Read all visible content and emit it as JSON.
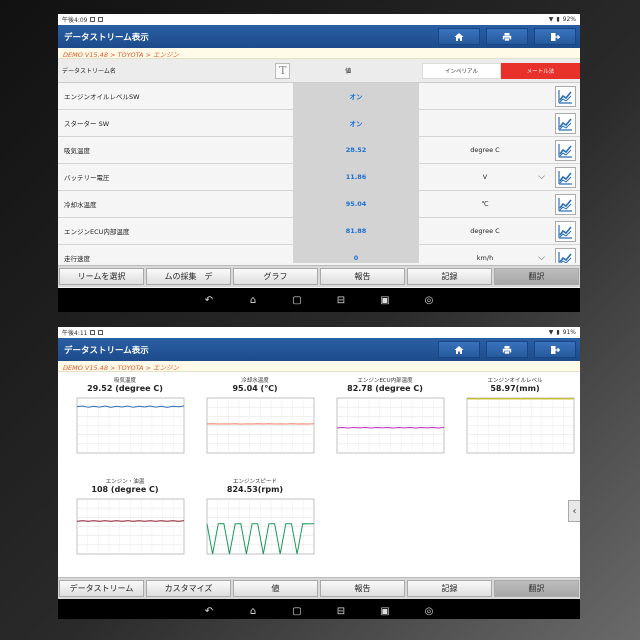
{
  "screen1": {
    "status": {
      "time": "午後4:09",
      "battery": "92%"
    },
    "title": "データストリーム表示",
    "breadcrumb": "DEMO V15.48 > TOYOTA > エンジン",
    "header": {
      "name": "データストリーム名",
      "value": "値",
      "imperial": "インペリアル",
      "metric": "メートル法"
    },
    "rows": [
      {
        "name": "エンジンオイルレベルSW",
        "value": "オン",
        "unit": "",
        "dropdown": false
      },
      {
        "name": "スターター SW",
        "value": "オン",
        "unit": "",
        "dropdown": false
      },
      {
        "name": "吸気温度",
        "value": "28.52",
        "unit": "degree C",
        "dropdown": false
      },
      {
        "name": "バッテリー電圧",
        "value": "11.86",
        "unit": "V",
        "dropdown": true
      },
      {
        "name": "冷却水温度",
        "value": "95.04",
        "unit": "℃",
        "dropdown": false
      },
      {
        "name": "エンジンECU内部温度",
        "value": "81.88",
        "unit": "degree C",
        "dropdown": false
      },
      {
        "name": "走行速度",
        "value": "0",
        "unit": "km/h",
        "dropdown": true
      }
    ],
    "buttons": [
      "リームを選択",
      "ムの採集　デ",
      "グラフ",
      "報告",
      "記録",
      "翻訳"
    ]
  },
  "screen2": {
    "status": {
      "time": "午後4:11",
      "battery": "91%"
    },
    "title": "データストリーム表示",
    "breadcrumb": "DEMO V15.48 > TOYOTA > エンジン",
    "buttons": [
      "データストリーム",
      "カスタマイズ",
      "値",
      "報告",
      "記録",
      "翻訳"
    ]
  },
  "chart_data": [
    {
      "type": "line",
      "title": "吸気温度",
      "value_label": "29.52 (degree C)",
      "series": [
        {
          "values": [
            29.5,
            29.9,
            29.1,
            29.8,
            29.2,
            29.9,
            29.0,
            29.7,
            29.3,
            29.9,
            29.1,
            29.8,
            29.3,
            29.9,
            29.2,
            29.7,
            29.0,
            29.8,
            29.4,
            29.9
          ]
        }
      ],
      "ylim": [
        0,
        35
      ],
      "color": "#2b6fb5"
    },
    {
      "type": "line",
      "title": "冷却水温度",
      "value_label": "95.04 (℃)",
      "series": [
        {
          "values": [
            95,
            95.5,
            94.8,
            95.3,
            94.9,
            95.6,
            94.7,
            95.2,
            95.0,
            95.5,
            94.8,
            95.4,
            95.0,
            95.3,
            94.9,
            95.5,
            94.8,
            95.2,
            95.0,
            95.4
          ]
        }
      ],
      "ylim": [
        0,
        180
      ],
      "color": "#f08060"
    },
    {
      "type": "line",
      "title": "エンジンECU内部温度",
      "value_label": "82.78 (degree C)",
      "series": [
        {
          "values": [
            82,
            83.5,
            81.9,
            83.6,
            82.0,
            83.4,
            81.8,
            83.5,
            82.1,
            83.6,
            81.9,
            83.5,
            82.0,
            83.4,
            81.8,
            83.6,
            82.1,
            83.5,
            81.9,
            83.4
          ]
        }
      ],
      "ylim": [
        0,
        180
      ],
      "color": "#c030c0"
    },
    {
      "type": "line",
      "title": "エンジンオイルレベル",
      "value_label": "58.97(mm)",
      "series": [
        {
          "values": [
            59,
            59.2,
            58.9,
            59.1,
            59.0,
            59.2,
            58.9,
            59.1,
            59.0,
            59.2,
            58.9,
            59.1,
            59.0,
            59.2,
            58.9,
            59.1,
            59.0,
            59.2,
            58.9,
            59.1
          ]
        }
      ],
      "ylim": [
        0,
        60
      ],
      "color": "#c8b800"
    },
    {
      "type": "line",
      "title": "エンジン・油温",
      "value_label": "108 (degree C)",
      "series": [
        {
          "values": [
            107,
            109,
            107.5,
            108.8,
            107,
            109,
            107.3,
            108.9,
            107.1,
            109,
            107.4,
            108.8,
            107,
            109,
            107.2,
            108.9,
            107.1,
            109,
            107.4,
            108.7
          ]
        }
      ],
      "ylim": [
        0,
        180
      ],
      "color": "#8b1a2b"
    },
    {
      "type": "line",
      "title": "エンジンスピード",
      "value_label": "824.53(rpm)",
      "series": [
        {
          "values": [
            820,
            0,
            825,
            830,
            0,
            822,
            828,
            0,
            826,
            824,
            0,
            821,
            829,
            0,
            823,
            827,
            0,
            825,
            822,
            824
          ]
        }
      ],
      "ylim": [
        0,
        1500
      ],
      "color": "#1a9a5a"
    }
  ],
  "colors": {
    "titlebar": "#1d4b8b",
    "value_text": "#1f6fd1",
    "metric_active": "#e8312a",
    "breadcrumb": "#e1572a"
  },
  "icons": [
    "home-icon",
    "print-icon",
    "exit-icon",
    "graph-icon",
    "chevron-down-icon",
    "back-icon",
    "nav-home-icon",
    "recent-apps-icon",
    "gamepad-icon",
    "gallery-icon",
    "screenshot-icon",
    "chevron-left-icon"
  ]
}
